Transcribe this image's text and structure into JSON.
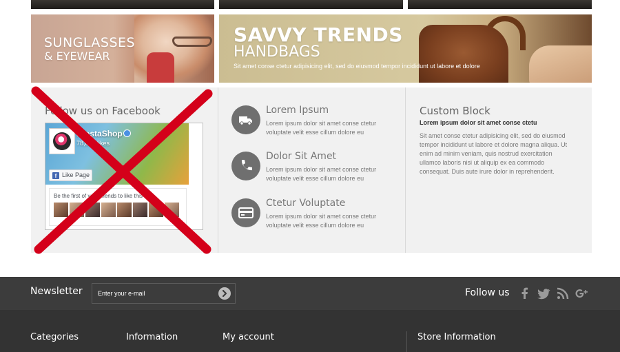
{
  "banners": {
    "sunglasses": {
      "title": "SUNGLASSES",
      "subtitle": "& EYEWEAR"
    },
    "handbags": {
      "title": "SAVVY TRENDS",
      "subtitle": "HANDBAGS",
      "text": "Sit amet conse ctetur adipisicing elit, sed do eiusmod tempor incididunt ut labore et dolore"
    }
  },
  "facebook": {
    "heading": "Follow us on Facebook",
    "page_name": "PrestaShop",
    "likes": "78,851 likes",
    "like_button": "Like Page",
    "friends_text": "Be the first of your friends to like this",
    "overlay_color": "#d4001a"
  },
  "services": [
    {
      "icon": "truck-icon",
      "title": "Lorem Ipsum",
      "text": "Lorem ipsum dolor sit amet conse ctetur voluptate velit esse cillum dolore eu"
    },
    {
      "icon": "phone-icon",
      "title": "Dolor Sit Amet",
      "text": "Lorem ipsum dolor sit amet conse ctetur voluptate velit esse cillum dolore eu"
    },
    {
      "icon": "credit-card-icon",
      "title": "Ctetur Voluptate",
      "text": "Lorem ipsum dolor sit amet conse ctetur voluptate velit esse cillum dolore eu"
    }
  ],
  "custom_block": {
    "heading": "Custom Block",
    "bold": "Lorem ipsum dolor sit amet conse ctetu",
    "text": "Sit amet conse ctetur adipisicing elit, sed do eiusmod tempor incididunt ut labore et dolore magna aliqua. Ut enim ad minim veniam, quis nostrud exercitation ullamco laboris nisi ut aliquip ex ea commodo consequat. Duis aute irure dolor in reprehenderit."
  },
  "newsletter": {
    "title": "Newsletter",
    "placeholder": "Enter your e-mail"
  },
  "follow": {
    "title": "Follow us",
    "networks": [
      "facebook-icon",
      "twitter-icon",
      "rss-icon",
      "google-plus-icon"
    ]
  },
  "footer": {
    "headings": [
      "Categories",
      "Information",
      "My account",
      "Store Information"
    ]
  }
}
